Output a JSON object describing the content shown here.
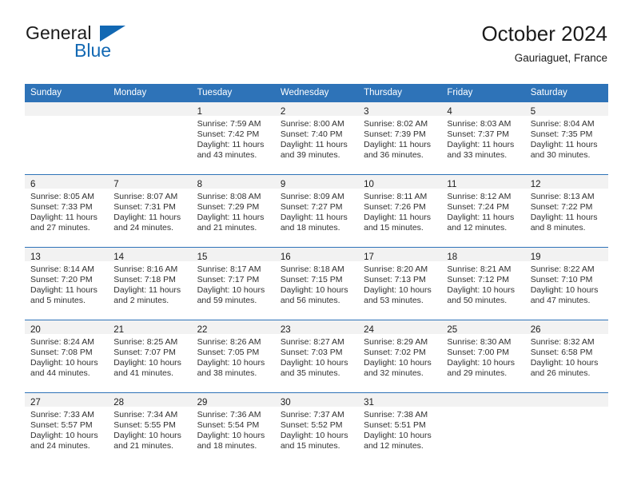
{
  "brand": {
    "name_part1": "General",
    "name_part2": "Blue",
    "triangle_color": "#1268b3",
    "text_color": "#1b1b1b"
  },
  "header": {
    "title": "October 2024",
    "subtitle": "Gauriaguet, France"
  },
  "theme": {
    "header_bg": "#2e73b8",
    "header_text": "#ffffff",
    "daynum_band_bg": "#f2f2f2",
    "row_separator": "#2e73b8",
    "body_text": "#303030"
  },
  "calendar": {
    "weekday_headers": [
      "Sunday",
      "Monday",
      "Tuesday",
      "Wednesday",
      "Thursday",
      "Friday",
      "Saturday"
    ],
    "weeks": [
      [
        {
          "day": "",
          "sunrise": "",
          "sunset": "",
          "daylight_line1": "",
          "daylight_line2": ""
        },
        {
          "day": "",
          "sunrise": "",
          "sunset": "",
          "daylight_line1": "",
          "daylight_line2": ""
        },
        {
          "day": "1",
          "sunrise": "Sunrise: 7:59 AM",
          "sunset": "Sunset: 7:42 PM",
          "daylight_line1": "Daylight: 11 hours",
          "daylight_line2": "and 43 minutes."
        },
        {
          "day": "2",
          "sunrise": "Sunrise: 8:00 AM",
          "sunset": "Sunset: 7:40 PM",
          "daylight_line1": "Daylight: 11 hours",
          "daylight_line2": "and 39 minutes."
        },
        {
          "day": "3",
          "sunrise": "Sunrise: 8:02 AM",
          "sunset": "Sunset: 7:39 PM",
          "daylight_line1": "Daylight: 11 hours",
          "daylight_line2": "and 36 minutes."
        },
        {
          "day": "4",
          "sunrise": "Sunrise: 8:03 AM",
          "sunset": "Sunset: 7:37 PM",
          "daylight_line1": "Daylight: 11 hours",
          "daylight_line2": "and 33 minutes."
        },
        {
          "day": "5",
          "sunrise": "Sunrise: 8:04 AM",
          "sunset": "Sunset: 7:35 PM",
          "daylight_line1": "Daylight: 11 hours",
          "daylight_line2": "and 30 minutes."
        }
      ],
      [
        {
          "day": "6",
          "sunrise": "Sunrise: 8:05 AM",
          "sunset": "Sunset: 7:33 PM",
          "daylight_line1": "Daylight: 11 hours",
          "daylight_line2": "and 27 minutes."
        },
        {
          "day": "7",
          "sunrise": "Sunrise: 8:07 AM",
          "sunset": "Sunset: 7:31 PM",
          "daylight_line1": "Daylight: 11 hours",
          "daylight_line2": "and 24 minutes."
        },
        {
          "day": "8",
          "sunrise": "Sunrise: 8:08 AM",
          "sunset": "Sunset: 7:29 PM",
          "daylight_line1": "Daylight: 11 hours",
          "daylight_line2": "and 21 minutes."
        },
        {
          "day": "9",
          "sunrise": "Sunrise: 8:09 AM",
          "sunset": "Sunset: 7:27 PM",
          "daylight_line1": "Daylight: 11 hours",
          "daylight_line2": "and 18 minutes."
        },
        {
          "day": "10",
          "sunrise": "Sunrise: 8:11 AM",
          "sunset": "Sunset: 7:26 PM",
          "daylight_line1": "Daylight: 11 hours",
          "daylight_line2": "and 15 minutes."
        },
        {
          "day": "11",
          "sunrise": "Sunrise: 8:12 AM",
          "sunset": "Sunset: 7:24 PM",
          "daylight_line1": "Daylight: 11 hours",
          "daylight_line2": "and 12 minutes."
        },
        {
          "day": "12",
          "sunrise": "Sunrise: 8:13 AM",
          "sunset": "Sunset: 7:22 PM",
          "daylight_line1": "Daylight: 11 hours",
          "daylight_line2": "and 8 minutes."
        }
      ],
      [
        {
          "day": "13",
          "sunrise": "Sunrise: 8:14 AM",
          "sunset": "Sunset: 7:20 PM",
          "daylight_line1": "Daylight: 11 hours",
          "daylight_line2": "and 5 minutes."
        },
        {
          "day": "14",
          "sunrise": "Sunrise: 8:16 AM",
          "sunset": "Sunset: 7:18 PM",
          "daylight_line1": "Daylight: 11 hours",
          "daylight_line2": "and 2 minutes."
        },
        {
          "day": "15",
          "sunrise": "Sunrise: 8:17 AM",
          "sunset": "Sunset: 7:17 PM",
          "daylight_line1": "Daylight: 10 hours",
          "daylight_line2": "and 59 minutes."
        },
        {
          "day": "16",
          "sunrise": "Sunrise: 8:18 AM",
          "sunset": "Sunset: 7:15 PM",
          "daylight_line1": "Daylight: 10 hours",
          "daylight_line2": "and 56 minutes."
        },
        {
          "day": "17",
          "sunrise": "Sunrise: 8:20 AM",
          "sunset": "Sunset: 7:13 PM",
          "daylight_line1": "Daylight: 10 hours",
          "daylight_line2": "and 53 minutes."
        },
        {
          "day": "18",
          "sunrise": "Sunrise: 8:21 AM",
          "sunset": "Sunset: 7:12 PM",
          "daylight_line1": "Daylight: 10 hours",
          "daylight_line2": "and 50 minutes."
        },
        {
          "day": "19",
          "sunrise": "Sunrise: 8:22 AM",
          "sunset": "Sunset: 7:10 PM",
          "daylight_line1": "Daylight: 10 hours",
          "daylight_line2": "and 47 minutes."
        }
      ],
      [
        {
          "day": "20",
          "sunrise": "Sunrise: 8:24 AM",
          "sunset": "Sunset: 7:08 PM",
          "daylight_line1": "Daylight: 10 hours",
          "daylight_line2": "and 44 minutes."
        },
        {
          "day": "21",
          "sunrise": "Sunrise: 8:25 AM",
          "sunset": "Sunset: 7:07 PM",
          "daylight_line1": "Daylight: 10 hours",
          "daylight_line2": "and 41 minutes."
        },
        {
          "day": "22",
          "sunrise": "Sunrise: 8:26 AM",
          "sunset": "Sunset: 7:05 PM",
          "daylight_line1": "Daylight: 10 hours",
          "daylight_line2": "and 38 minutes."
        },
        {
          "day": "23",
          "sunrise": "Sunrise: 8:27 AM",
          "sunset": "Sunset: 7:03 PM",
          "daylight_line1": "Daylight: 10 hours",
          "daylight_line2": "and 35 minutes."
        },
        {
          "day": "24",
          "sunrise": "Sunrise: 8:29 AM",
          "sunset": "Sunset: 7:02 PM",
          "daylight_line1": "Daylight: 10 hours",
          "daylight_line2": "and 32 minutes."
        },
        {
          "day": "25",
          "sunrise": "Sunrise: 8:30 AM",
          "sunset": "Sunset: 7:00 PM",
          "daylight_line1": "Daylight: 10 hours",
          "daylight_line2": "and 29 minutes."
        },
        {
          "day": "26",
          "sunrise": "Sunrise: 8:32 AM",
          "sunset": "Sunset: 6:58 PM",
          "daylight_line1": "Daylight: 10 hours",
          "daylight_line2": "and 26 minutes."
        }
      ],
      [
        {
          "day": "27",
          "sunrise": "Sunrise: 7:33 AM",
          "sunset": "Sunset: 5:57 PM",
          "daylight_line1": "Daylight: 10 hours",
          "daylight_line2": "and 24 minutes."
        },
        {
          "day": "28",
          "sunrise": "Sunrise: 7:34 AM",
          "sunset": "Sunset: 5:55 PM",
          "daylight_line1": "Daylight: 10 hours",
          "daylight_line2": "and 21 minutes."
        },
        {
          "day": "29",
          "sunrise": "Sunrise: 7:36 AM",
          "sunset": "Sunset: 5:54 PM",
          "daylight_line1": "Daylight: 10 hours",
          "daylight_line2": "and 18 minutes."
        },
        {
          "day": "30",
          "sunrise": "Sunrise: 7:37 AM",
          "sunset": "Sunset: 5:52 PM",
          "daylight_line1": "Daylight: 10 hours",
          "daylight_line2": "and 15 minutes."
        },
        {
          "day": "31",
          "sunrise": "Sunrise: 7:38 AM",
          "sunset": "Sunset: 5:51 PM",
          "daylight_line1": "Daylight: 10 hours",
          "daylight_line2": "and 12 minutes."
        },
        {
          "day": "",
          "sunrise": "",
          "sunset": "",
          "daylight_line1": "",
          "daylight_line2": ""
        },
        {
          "day": "",
          "sunrise": "",
          "sunset": "",
          "daylight_line1": "",
          "daylight_line2": ""
        }
      ]
    ]
  }
}
